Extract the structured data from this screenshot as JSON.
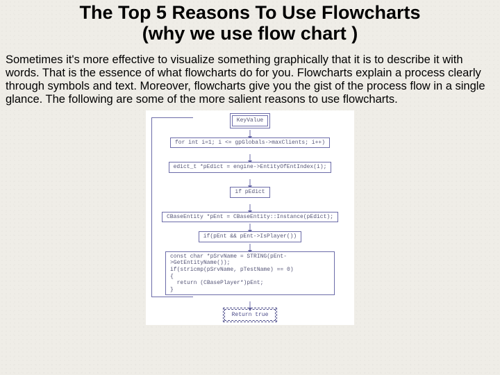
{
  "title": "The Top 5 Reasons To Use Flowcharts",
  "subtitle": "(why we use flow chart )",
  "paragraph": "Sometimes it's more effective to visualize something graphically that it is to describe it with words. That is the essence of what flowcharts do for you. Flowcharts explain a process clearly through symbols and text. Moreover, flowcharts give you the gist of the process flow in a single glance. The following are some of the more salient reasons to use flowcharts.",
  "chart_data": {
    "type": "flowchart",
    "title": "",
    "nodes": [
      {
        "id": "n0",
        "kind": "terminal",
        "label": "KeyValue"
      },
      {
        "id": "n1",
        "kind": "process",
        "label": "for int i=1; i <= gpGlobals->maxClients; i++)"
      },
      {
        "id": "n2",
        "kind": "process",
        "label": "edict_t *pEdict = engine->EntityOfEntIndex(i);"
      },
      {
        "id": "n3",
        "kind": "decision",
        "label": "if pEdict"
      },
      {
        "id": "n4",
        "kind": "process",
        "label": "CBaseEntity *pEnt = CBaseEntity::Instance(pEdict);"
      },
      {
        "id": "n5",
        "kind": "decision",
        "label": "if(pEnt && pEnt->IsPlayer())"
      },
      {
        "id": "n6",
        "kind": "process",
        "label": "const char *pSrvName = STRING(pEnt->GetEntityName());\nif(stricmp(pSrvName, pTestName) == 0)\n{\n  return (CBasePlayer*)pEnt;\n}"
      },
      {
        "id": "n7",
        "kind": "terminal",
        "label": "Return true"
      }
    ],
    "edges": [
      {
        "from": "n0",
        "to": "n1"
      },
      {
        "from": "n1",
        "to": "n2"
      },
      {
        "from": "n2",
        "to": "n3"
      },
      {
        "from": "n3",
        "to": "n4"
      },
      {
        "from": "n4",
        "to": "n5"
      },
      {
        "from": "n5",
        "to": "n6"
      },
      {
        "from": "n6",
        "to": "n7"
      },
      {
        "from": "n6",
        "to": "n1",
        "kind": "loop-back"
      }
    ]
  }
}
